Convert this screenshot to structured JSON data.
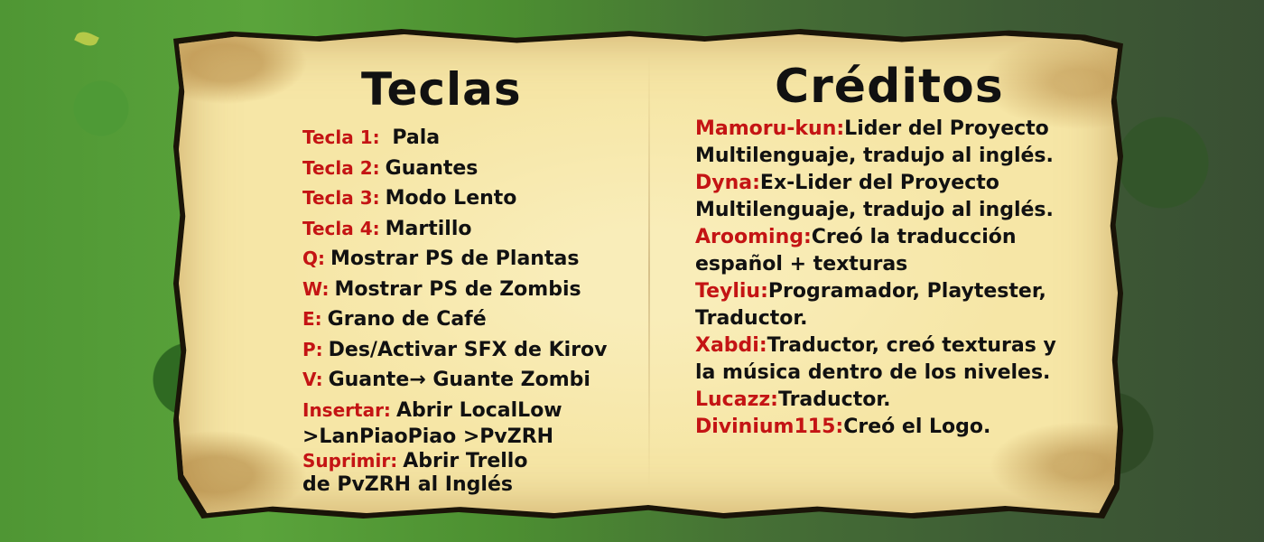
{
  "keys": {
    "title": "Teclas",
    "items": [
      {
        "key": "Tecla 1:",
        "action": "Pala"
      },
      {
        "key": "Tecla 2:",
        "action": "Guantes"
      },
      {
        "key": "Tecla 3:",
        "action": "Modo Lento"
      },
      {
        "key": "Tecla 4:",
        "action": "Martillo"
      },
      {
        "key": "Q:",
        "action": "Mostrar PS de Plantas"
      },
      {
        "key": "W:",
        "action": "Mostrar PS de Zombis"
      },
      {
        "key": "E:",
        "action": "Grano de Café"
      },
      {
        "key": "P:",
        "action": "Des/Activar SFX de Kirov"
      },
      {
        "key": "V:",
        "action": "Guante→ Guante Zombi"
      },
      {
        "key": "Insertar:",
        "action": "Abrir LocalLow",
        "action2": ">LanPiaoPiao >PvZRH"
      },
      {
        "key": "Suprimir:",
        "action": "Abrir Trello",
        "action2": "de PvZRH al Inglés"
      }
    ]
  },
  "credits": {
    "title": "Créditos",
    "items": [
      {
        "name": "Mamoru-kun:",
        "text": "Lider del Proyecto",
        "text2": "Multilenguaje, tradujo al inglés."
      },
      {
        "name": "Dyna:",
        "text": "Ex-Lider del Proyecto",
        "text2": "Multilenguaje, tradujo al inglés."
      },
      {
        "name": "Arooming:",
        "text": "Creó la traducción",
        "text2": "español + texturas"
      },
      {
        "name": "Teyliu:",
        "text": "Programador, Playtester,",
        "text2": "Traductor."
      },
      {
        "name": "Xabdi:",
        "text": "Traductor, creó texturas y",
        "text2": "la música dentro de los niveles."
      },
      {
        "name": "Lucazz:",
        "text": "Traductor."
      },
      {
        "name": "Divinium115:",
        "text": "Creó el Logo."
      }
    ]
  },
  "colors": {
    "label_red": "#c41414",
    "paper": "#f6e6a6",
    "ink": "#111111"
  }
}
